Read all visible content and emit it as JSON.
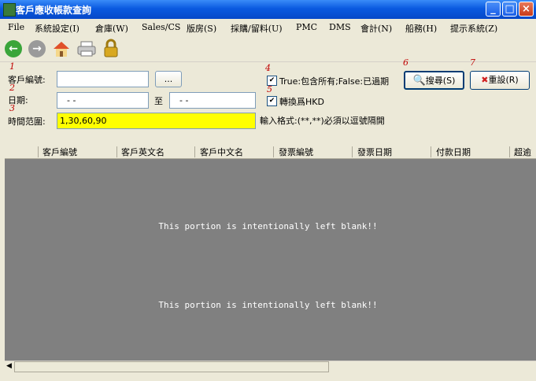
{
  "window": {
    "title": "客戶應收帳款查詢"
  },
  "menu": {
    "items": [
      "File",
      "系統設定(I)",
      "倉庫(W)",
      "Sales/CS",
      "版房(S)",
      "採購/留料(U)",
      "PMC",
      "DMS",
      "會計(N)",
      "船務(H)",
      "提示系統(Z)"
    ]
  },
  "fields": {
    "customer_label": "客戶編號:",
    "browse_label": "...",
    "date_label": "日期:",
    "date_from": " - -",
    "date_to_label": "至",
    "date_to": " - -",
    "range_label": "時間范圍:",
    "range_value": "1,30,60,90",
    "range_hint": "輸入格式:(**,**)必須以逗號隔開",
    "include_all_label": "True:包含所有;False:已過期",
    "convert_hkd_label": "轉換爲HKD",
    "check_mark": "✔"
  },
  "buttons": {
    "search": "搜尋(S)",
    "reset": "重設(R)"
  },
  "annotations": [
    "1",
    "2",
    "3",
    "4",
    "5",
    "6",
    "7"
  ],
  "grid": {
    "columns": [
      "客戶編號",
      "客戶英文名",
      "客戶中文名",
      "發票編號",
      "發票日期",
      "付款日期",
      "超逾"
    ],
    "blank_text": "This portion is intentionally left blank!!"
  }
}
